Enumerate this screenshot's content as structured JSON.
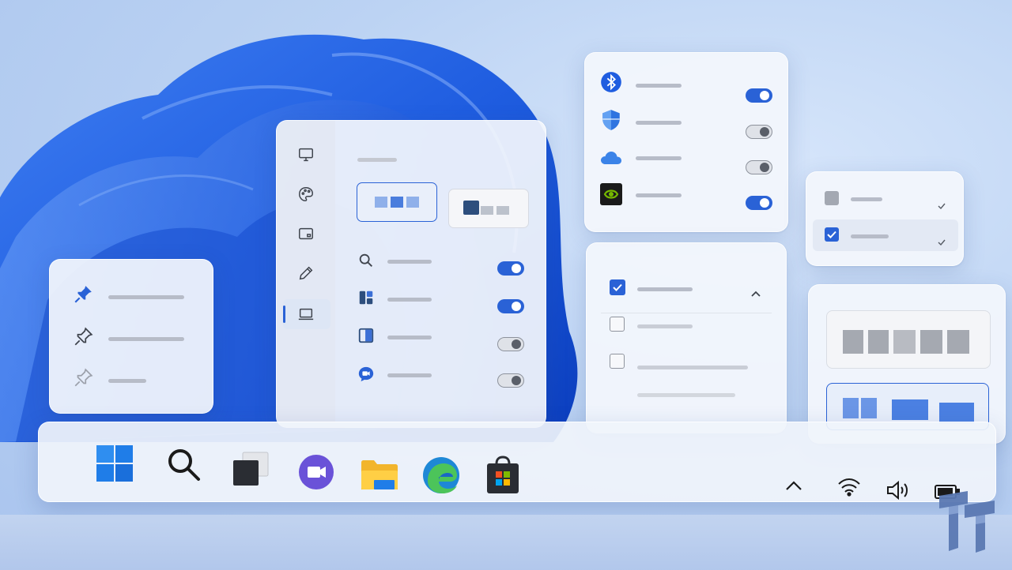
{
  "colors": {
    "accent": "#2a62d6",
    "bloom": "#1f5de0",
    "background": "#bcd3f3"
  },
  "settings_panel": {
    "nav_icons": [
      "monitor-icon",
      "palette-icon",
      "tablet-icon",
      "pen-icon",
      "laptop-icon"
    ],
    "active_nav": "laptop-icon",
    "layout_options": [
      "three-column-layout",
      "folder-layout"
    ],
    "selected_layout": "three-column-layout",
    "rows": [
      {
        "icon": "search-icon",
        "state": "on"
      },
      {
        "icon": "widgets-icon",
        "state": "on"
      },
      {
        "icon": "snap-layout-icon",
        "state": "off"
      },
      {
        "icon": "meet-chat-icon",
        "state": "off"
      }
    ]
  },
  "quick_settings": {
    "rows": [
      {
        "icon": "bluetooth-icon",
        "state": "on"
      },
      {
        "icon": "shield-icon",
        "state": "off"
      },
      {
        "icon": "cloud-icon",
        "state": "off"
      },
      {
        "icon": "nvidia-icon",
        "state": "on"
      }
    ]
  },
  "pin_panel": {
    "items": [
      "pin-filled-icon",
      "pin-outline-icon",
      "pin-faded-icon"
    ]
  },
  "checklist_panel": {
    "items": [
      true,
      false,
      false
    ],
    "chevron": "chevron-up-icon"
  },
  "small_check_panel": {
    "items": [
      false,
      true
    ]
  },
  "taskbar": {
    "apps": [
      "start-icon",
      "search-icon",
      "task-view-icon",
      "teams-icon",
      "file-explorer-icon",
      "edge-icon",
      "store-icon"
    ],
    "tray": [
      "chevron-up-icon",
      "wifi-icon",
      "volume-icon",
      "battery-icon"
    ]
  }
}
